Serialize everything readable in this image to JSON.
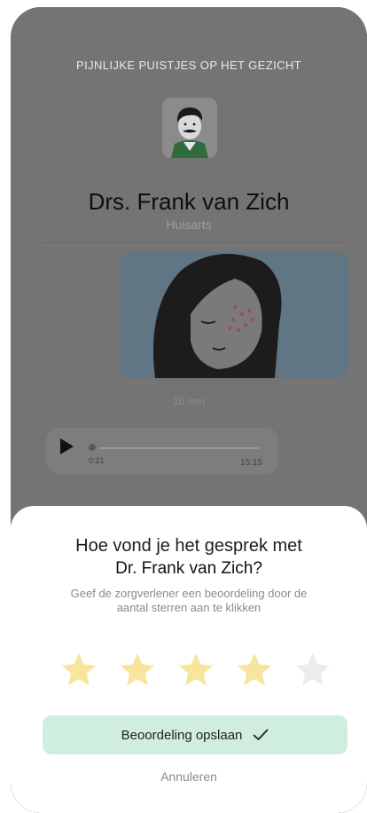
{
  "conversation": {
    "topic": "PIJNLIJKE PUISTJES OP HET GEZICHT",
    "doctor_name": "Drs. Frank van Zich",
    "doctor_role": "Huisarts",
    "date": "16 mei",
    "audio": {
      "current_time": "0:21",
      "duration": "15:15"
    }
  },
  "rating_sheet": {
    "question_line1": "Hoe vond je het gesprek met",
    "question_line2": "Dr. Frank van Zich?",
    "hint": "Geef de zorgverlener een beoordeling door de aantal sterren aan te klikken",
    "rating": 4,
    "max_rating": 5,
    "save_label": "Beoordeling opslaan",
    "cancel_label": "Annuleren"
  },
  "colors": {
    "star_filled": "#f6e59a",
    "star_empty": "#ececec",
    "save_button_bg": "#cfeedd",
    "overlay": "#747474"
  },
  "icons": [
    "avatar",
    "play-icon",
    "star-icon",
    "check-icon"
  ]
}
